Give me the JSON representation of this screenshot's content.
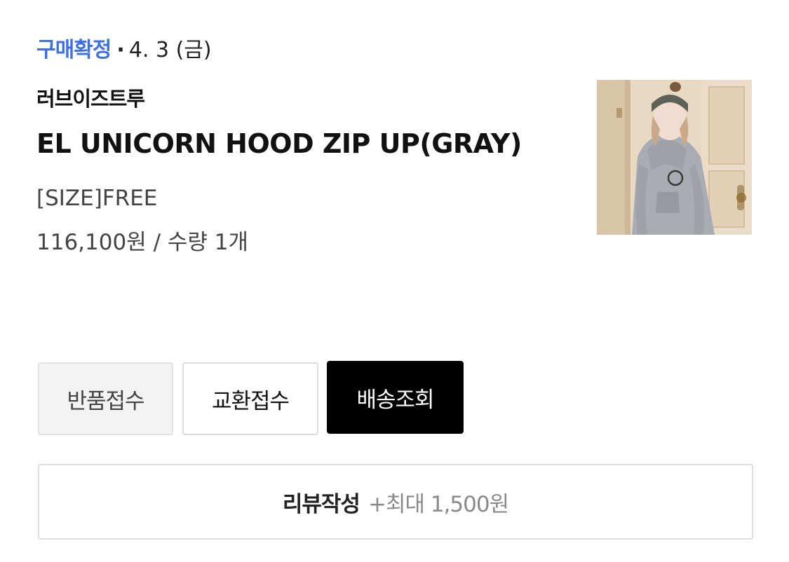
{
  "order": {
    "status_label": "구매확정",
    "separator": "·",
    "date": "4. 3 (금)"
  },
  "product": {
    "brand": "러브이즈트루",
    "name": "EL UNICORN HOOD ZIP UP(GRAY)",
    "option": "[SIZE]FREE",
    "price_qty": "116,100원 / 수량 1개",
    "thumbnail_icon": "product-photo"
  },
  "actions": {
    "return_label": "반품접수",
    "exchange_label": "교환접수",
    "tracking_label": "배송조회"
  },
  "review": {
    "label": "리뷰작성",
    "reward": "+최대 1,500원"
  },
  "colors": {
    "status_accent": "#3d6fe6",
    "primary_button": "#000000",
    "secondary_button_bg": "#f3f3f3"
  }
}
